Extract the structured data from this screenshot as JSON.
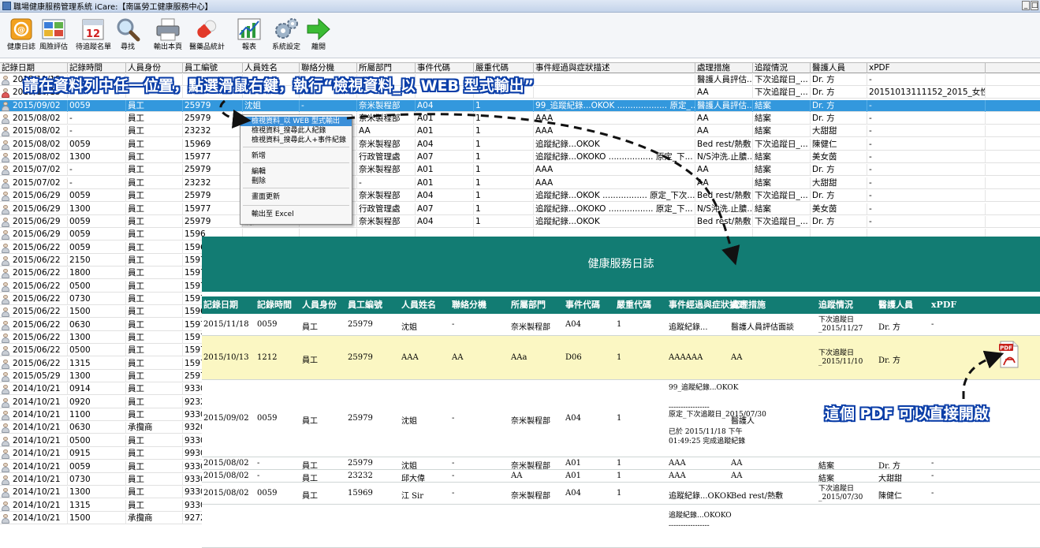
{
  "window": {
    "title": "職場健康服務管理系統 iCare:【南區勞工健康服務中心】",
    "min": "_",
    "max": "□"
  },
  "toolbar": [
    {
      "label": "健康日誌",
      "icon": "journal-icon"
    },
    {
      "label": "風險評估",
      "icon": "risk-assessment-icon"
    },
    {
      "label": "待追蹤名單",
      "icon": "calendar-icon"
    },
    {
      "label": "尋找",
      "icon": "magnifier-icon"
    },
    {
      "label": "輸出本頁",
      "icon": "printer-icon"
    },
    {
      "label": "醫藥品統計",
      "icon": "pill-icon"
    },
    {
      "label": "報表",
      "icon": "chart-icon"
    },
    {
      "label": "系統設定",
      "icon": "settings-gears-icon"
    },
    {
      "label": "離開",
      "icon": "exit-arrow-icon"
    }
  ],
  "columns": [
    "記錄日期",
    "記錄時間",
    "人員身份",
    "員工編號",
    "人員姓名",
    "聯絡分機",
    "所屬部門",
    "事件代碼",
    "嚴重代碼",
    "事件經過與症狀描述",
    "處理措施",
    "追蹤情況",
    "醫護人員",
    "xPDF"
  ],
  "rows": [
    [
      "2015/11/18",
      "",
      "",
      "",
      "",
      "",
      "",
      "",
      "",
      "",
      "醫護人員評估...",
      "下次追蹤日_...",
      "Dr. 方",
      "-"
    ],
    [
      "2015/10/13",
      "",
      "",
      "",
      "",
      "",
      "",
      "",
      "",
      "",
      "AA",
      "下次追蹤日_...",
      "Dr. 方",
      "20151013111152_2015_女性勞..."
    ],
    [
      "2015/09/02",
      "0059",
      "員工",
      "25979",
      "沈姐",
      "-",
      "奈米製程部",
      "A04",
      "1",
      "99_追蹤紀錄...OKOK ................... 原定_...",
      "醫護人員評估...",
      "結案",
      "Dr. 方",
      "-"
    ],
    [
      "2015/08/02",
      "-",
      "員工",
      "25979",
      "",
      "",
      "奈米製程部",
      "A01",
      "1",
      "AAA",
      "AA",
      "結案",
      "Dr. 方",
      "-"
    ],
    [
      "2015/08/02",
      "-",
      "員工",
      "23232",
      "",
      "",
      "AA",
      "A01",
      "1",
      "AAA",
      "AA",
      "結案",
      "大甜甜",
      "-"
    ],
    [
      "2015/08/02",
      "0059",
      "員工",
      "15969",
      "",
      "",
      "奈米製程部",
      "A04",
      "1",
      "追蹤紀錄...OKOK",
      "Bed rest/熱敷",
      "下次追蹤日_...",
      "陳健仁",
      "-"
    ],
    [
      "2015/08/02",
      "1300",
      "員工",
      "15977",
      "",
      "",
      "行政管理處",
      "A07",
      "1",
      "追蹤紀錄...OKOKO ................. 原定_下...",
      "N/S沖洗.止膿...",
      "結案",
      "美女茵",
      "-"
    ],
    [
      "2015/07/02",
      "-",
      "員工",
      "25979",
      "",
      "",
      "奈米製程部",
      "A01",
      "1",
      "AAA",
      "AA",
      "結案",
      "Dr. 方",
      "-"
    ],
    [
      "2015/07/02",
      "-",
      "員工",
      "23232",
      "",
      "",
      "-",
      "A01",
      "1",
      "AAA",
      "AA",
      "結案",
      "大甜甜",
      "-"
    ],
    [
      "2015/06/29",
      "0059",
      "員工",
      "25979",
      "",
      "",
      "奈米製程部",
      "A04",
      "1",
      "追蹤紀錄...OKOK ................. 原定_下次...",
      "Bed rest/熱敷",
      "下次追蹤日_...",
      "Dr. 方",
      "-"
    ],
    [
      "2015/06/29",
      "1300",
      "員工",
      "15977",
      "",
      "",
      "行政管理處",
      "A07",
      "1",
      "追蹤紀錄...OKOKO ................. 原定_下...",
      "N/S沖洗.止膿...",
      "結案",
      "美女茵",
      "-"
    ],
    [
      "2015/06/29",
      "0059",
      "員工",
      "25979",
      "沈姐",
      "-",
      "奈米製程部",
      "A04",
      "1",
      "追蹤紀錄...OKOK",
      "Bed rest/熱敷",
      "下次追蹤日_...",
      "Dr. 方",
      "-"
    ],
    [
      "2015/06/29",
      "0059",
      "員工",
      "1596",
      "",
      "",
      "",
      "",
      "",
      "",
      "",
      "",
      "",
      ""
    ],
    [
      "2015/06/22",
      "0059",
      "員工",
      "1596",
      "",
      "",
      "",
      "",
      "",
      "",
      "",
      "",
      "",
      ""
    ],
    [
      "2015/06/22",
      "2150",
      "員工",
      "1597",
      "",
      "",
      "",
      "",
      "",
      "",
      "",
      "",
      "",
      ""
    ],
    [
      "2015/06/22",
      "1800",
      "員工",
      "1597",
      "",
      "",
      "",
      "",
      "",
      "",
      "",
      "",
      "",
      ""
    ],
    [
      "2015/06/22",
      "0500",
      "員工",
      "1597",
      "",
      "",
      "",
      "",
      "",
      "",
      "",
      "",
      "",
      ""
    ],
    [
      "2015/06/22",
      "0730",
      "員工",
      "1597",
      "",
      "",
      "",
      "",
      "",
      "",
      "",
      "",
      "",
      ""
    ],
    [
      "2015/06/22",
      "1500",
      "員工",
      "1596",
      "",
      "",
      "",
      "",
      "",
      "",
      "",
      "",
      "",
      ""
    ],
    [
      "2015/06/22",
      "0630",
      "員工",
      "1597",
      "",
      "",
      "",
      "",
      "",
      "",
      "",
      "",
      "",
      ""
    ],
    [
      "2015/06/22",
      "1300",
      "員工",
      "1597",
      "",
      "",
      "",
      "",
      "",
      "",
      "",
      "",
      "",
      ""
    ],
    [
      "2015/06/22",
      "0500",
      "員工",
      "1597",
      "",
      "",
      "",
      "",
      "",
      "",
      "",
      "",
      "",
      ""
    ],
    [
      "2015/06/22",
      "1315",
      "員工",
      "1597",
      "",
      "",
      "",
      "",
      "",
      "",
      "",
      "",
      "",
      ""
    ],
    [
      "2015/05/29",
      "1300",
      "員工",
      "2597",
      "",
      "",
      "",
      "",
      "",
      "",
      "",
      "",
      "",
      ""
    ],
    [
      "2014/10/21",
      "0914",
      "員工",
      "9330",
      "",
      "",
      "",
      "",
      "",
      "",
      "",
      "",
      "",
      ""
    ],
    [
      "2014/10/21",
      "0920",
      "員工",
      "9232",
      "",
      "",
      "",
      "",
      "",
      "",
      "",
      "",
      "",
      ""
    ],
    [
      "2014/10/21",
      "1100",
      "員工",
      "9330",
      "",
      "",
      "",
      "",
      "",
      "",
      "",
      "",
      "",
      ""
    ],
    [
      "2014/10/21",
      "0630",
      "承攬商",
      "9320",
      "",
      "",
      "",
      "",
      "",
      "",
      "",
      "",
      "",
      ""
    ],
    [
      "2014/10/21",
      "0500",
      "員工",
      "9330",
      "",
      "",
      "",
      "",
      "",
      "",
      "",
      "",
      "",
      ""
    ],
    [
      "2014/10/21",
      "0915",
      "員工",
      "9930",
      "",
      "",
      "",
      "",
      "",
      "",
      "",
      "",
      "",
      ""
    ],
    [
      "2014/10/21",
      "0059",
      "員工",
      "9330",
      "",
      "",
      "",
      "",
      "",
      "",
      "",
      "",
      "",
      ""
    ],
    [
      "2014/10/21",
      "0730",
      "員工",
      "9330",
      "",
      "",
      "",
      "",
      "",
      "",
      "",
      "",
      "",
      ""
    ],
    [
      "2014/10/21",
      "1300",
      "員工",
      "9330",
      "",
      "",
      "",
      "",
      "",
      "",
      "",
      "",
      "",
      ""
    ],
    [
      "2014/10/21",
      "1315",
      "員工",
      "9330",
      "",
      "",
      "",
      "",
      "",
      "",
      "",
      "",
      "",
      ""
    ],
    [
      "2014/10/21",
      "1500",
      "承攬商",
      "9272",
      "",
      "",
      "",
      "",
      "",
      "",
      "",
      "",
      "",
      ""
    ]
  ],
  "context_menu": [
    "檢視資料_以 WEB 型式輸出",
    "檢視資料_搜尋此人紀錄",
    "檢視資料_搜尋此人+事件紀錄",
    "新增",
    "編輯",
    "刪除",
    "畫面更新",
    "輸出至 Excel"
  ],
  "web": {
    "title": "健康服務日誌",
    "columns": [
      "記錄日期",
      "記錄時間",
      "人員身份",
      "員工編號",
      "人員姓名",
      "聯絡分機",
      "所屬部門",
      "事件代碼",
      "嚴重代碼",
      "事件經過與症狀描述",
      "處理措施",
      "追蹤情況",
      "醫護人員",
      "xPDF"
    ],
    "rows": [
      [
        "2015/11/18",
        "0059",
        "員工",
        "25979",
        "沈姐",
        "-",
        "奈米製程部",
        "A04",
        "1",
        "追蹤紀錄...",
        "醫護人員評估面談",
        "下次追蹤日 _2015/11/27",
        "Dr. 方",
        "-"
      ],
      [
        "2015/10/13",
        "1212",
        "員工",
        "25979",
        "AAA",
        "AA",
        "AAa",
        "D06",
        "1",
        "AAAAAA",
        "AA",
        "下次追蹤日 _2015/11/10",
        "Dr. 方",
        ""
      ],
      [
        "2015/09/02",
        "0059",
        "員工",
        "25979",
        "沈姐",
        "-",
        "奈米製程部",
        "A04",
        "1",
        "",
        "醫護人",
        "",
        "",
        ""
      ],
      [
        "2015/08/02",
        "-",
        "員工",
        "25979",
        "沈姐",
        "-",
        "奈米製程部",
        "A01",
        "1",
        "AAA",
        "AA",
        "結案",
        "Dr. 方",
        "-"
      ],
      [
        "2015/08/02",
        "-",
        "員工",
        "23232",
        "邱大偉",
        "-",
        "AA",
        "A01",
        "1",
        "AAA",
        "AA",
        "結案",
        "大甜甜",
        "-"
      ],
      [
        "2015/08/02",
        "0059",
        "員工",
        "15969",
        "江 Sir",
        "-",
        "奈米製程部",
        "A04",
        "1",
        "追蹤紀錄...OKOK",
        "Bed rest/熱敷",
        "下次追蹤日 _2015/07/30",
        "陳健仁",
        "-"
      ]
    ],
    "row3_desc": [
      "99_追蹤紀錄...OKOK",
      "-----------------",
      "原定_下次追蹤日_2015/07/30",
      "已於 2015/11/18 下午",
      "01:49:25 完成追蹤紀錄"
    ],
    "row7_desc": [
      "追蹤紀錄...OKOKO",
      "-----------------"
    ]
  },
  "callouts": {
    "top": "請在資料列中任一位置，點選滑鼠右鍵，執行“檢視資料_以 WEB 型式輸出”",
    "bottom": "這個 PDF 可以直接開啟"
  },
  "colors": {
    "selected_row": "#3398dd",
    "web_header": "#127c73",
    "highlight_row": "#fbf7c3",
    "callout_outline": "#0b3ea8"
  }
}
